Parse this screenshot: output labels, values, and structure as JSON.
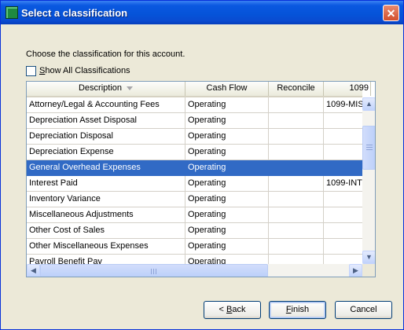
{
  "window": {
    "title": "Select a classification",
    "icon": "ledger-icon",
    "close_glyph": "✕"
  },
  "prompt": "Choose the classification for this account.",
  "show_all": {
    "label_accel": "S",
    "label_rest": "how All Classifications",
    "checked": false
  },
  "table": {
    "columns": [
      "Description",
      "Cash Flow",
      "Reconcile",
      "1099"
    ],
    "rows": [
      {
        "description": "Attorney/Legal & Accounting Fees",
        "cash_flow": "Operating",
        "reconcile": "",
        "form": "1099-MIS"
      },
      {
        "description": "Depreciation Asset Disposal",
        "cash_flow": "Operating",
        "reconcile": "",
        "form": ""
      },
      {
        "description": "Depreciation Disposal",
        "cash_flow": "Operating",
        "reconcile": "",
        "form": ""
      },
      {
        "description": "Depreciation Expense",
        "cash_flow": "Operating",
        "reconcile": "",
        "form": ""
      },
      {
        "description": "General Overhead Expenses",
        "cash_flow": "Operating",
        "reconcile": "",
        "form": "",
        "selected": true
      },
      {
        "description": "Interest Paid",
        "cash_flow": "Operating",
        "reconcile": "",
        "form": "1099-INT"
      },
      {
        "description": "Inventory Variance",
        "cash_flow": "Operating",
        "reconcile": "",
        "form": ""
      },
      {
        "description": "Miscellaneous Adjustments",
        "cash_flow": "Operating",
        "reconcile": "",
        "form": ""
      },
      {
        "description": "Other Cost of Sales",
        "cash_flow": "Operating",
        "reconcile": "",
        "form": ""
      },
      {
        "description": "Other Miscellaneous Expenses",
        "cash_flow": "Operating",
        "reconcile": "",
        "form": ""
      },
      {
        "description": "Payroll Benefit Pay",
        "cash_flow": "Operating",
        "reconcile": "",
        "form": ""
      }
    ]
  },
  "buttons": {
    "back_glyph": "<",
    "back_accel": "B",
    "back_rest": "ack",
    "finish_accel": "F",
    "finish_rest": "inish",
    "cancel": "Cancel"
  },
  "scroll_glyphs": {
    "up": "▲",
    "down": "▼",
    "left": "◀",
    "right": "▶"
  },
  "colors": {
    "titlebar": "#0553d8",
    "selection": "#316ac5",
    "face": "#ece9d8"
  }
}
